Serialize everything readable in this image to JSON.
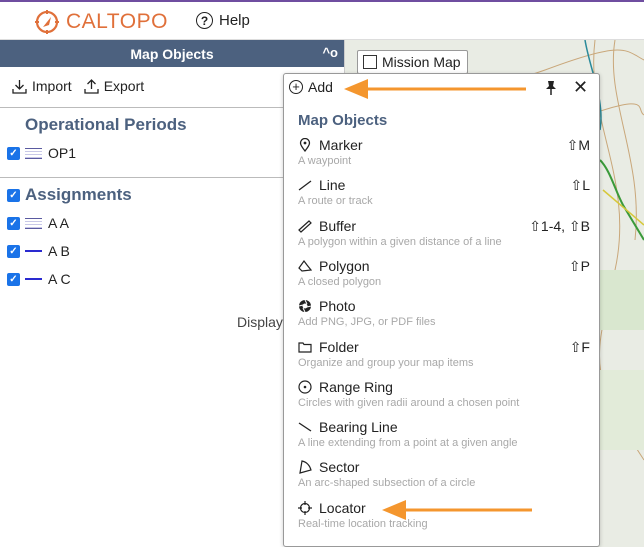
{
  "header": {
    "logo_text": "CALTOPO",
    "help_label": "Help"
  },
  "sidebar": {
    "title": "Map Objects",
    "collapse_label": "^o",
    "import_label": "Import",
    "export_label": "Export",
    "sections": [
      {
        "title": "Operational Periods",
        "items": [
          {
            "label": "OP1",
            "swatch": "box"
          }
        ]
      },
      {
        "title": "Assignments",
        "items": [
          {
            "label": "A A",
            "swatch": "box"
          },
          {
            "label": "A B",
            "swatch": "line"
          },
          {
            "label": "A C",
            "swatch": "line"
          }
        ]
      }
    ],
    "display_text": "Display"
  },
  "map": {
    "mission_map_label": "Mission Map"
  },
  "add_menu": {
    "add_label": "Add",
    "section_title": "Map Objects",
    "items": [
      {
        "icon": "marker-icon",
        "label": "Marker",
        "shortcut": "⇧M",
        "desc": "A waypoint"
      },
      {
        "icon": "line-icon",
        "label": "Line",
        "shortcut": "⇧L",
        "desc": "A route or track"
      },
      {
        "icon": "buffer-icon",
        "label": "Buffer",
        "shortcut": "⇧1-4, ⇧B",
        "desc": "A polygon within a given distance of a line"
      },
      {
        "icon": "polygon-icon",
        "label": "Polygon",
        "shortcut": "⇧P",
        "desc": "A closed polygon"
      },
      {
        "icon": "photo-icon",
        "label": "Photo",
        "shortcut": "",
        "desc": "Add PNG, JPG, or PDF files"
      },
      {
        "icon": "folder-icon",
        "label": "Folder",
        "shortcut": "⇧F",
        "desc": "Organize and group your map items"
      },
      {
        "icon": "range-ring-icon",
        "label": "Range Ring",
        "shortcut": "",
        "desc": "Circles with given radii around a chosen point"
      },
      {
        "icon": "bearing-line-icon",
        "label": "Bearing Line",
        "shortcut": "",
        "desc": "A line extending from a point at a given angle"
      },
      {
        "icon": "sector-icon",
        "label": "Sector",
        "shortcut": "",
        "desc": "An arc-shaped subsection of a circle"
      },
      {
        "icon": "locator-icon",
        "label": "Locator",
        "shortcut": "",
        "desc": "Real-time location tracking"
      }
    ]
  },
  "colors": {
    "accent": "#e0703a",
    "header": "#4c617f",
    "arrow": "#f4962e",
    "checkbox": "#1a73e8"
  }
}
